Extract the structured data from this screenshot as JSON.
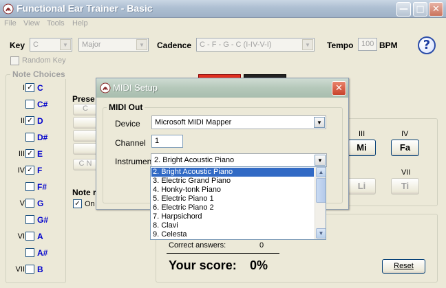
{
  "window": {
    "title": "Functional Ear Trainer - Basic"
  },
  "menu": [
    "File",
    "View",
    "Tools",
    "Help"
  ],
  "controls": {
    "key_label": "Key",
    "key_value": "C",
    "mode_value": "Major",
    "cadence_label": "Cadence",
    "cadence_value": "C - F - G - C (I-IV-V-I)",
    "tempo_label": "Tempo",
    "tempo_value": "100",
    "tempo_unit": "BPM",
    "random_key_label": "Random Key"
  },
  "note_choices": {
    "title": "Note Choices",
    "items": [
      {
        "roman": "I",
        "note": "C",
        "checked": true
      },
      {
        "roman": "",
        "note": "C#",
        "checked": false
      },
      {
        "roman": "II",
        "note": "D",
        "checked": true
      },
      {
        "roman": "",
        "note": "D#",
        "checked": false
      },
      {
        "roman": "III",
        "note": "E",
        "checked": true
      },
      {
        "roman": "IV",
        "note": "F",
        "checked": true
      },
      {
        "roman": "",
        "note": "F#",
        "checked": false
      },
      {
        "roman": "V",
        "note": "G",
        "checked": false
      },
      {
        "roman": "",
        "note": "G#",
        "checked": false
      },
      {
        "roman": "VI",
        "note": "A",
        "checked": false
      },
      {
        "roman": "",
        "note": "A#",
        "checked": false
      },
      {
        "roman": "VII",
        "note": "B",
        "checked": false
      }
    ]
  },
  "presets": {
    "label": "Prese",
    "partial_c": "C",
    "partial_cn": "C N"
  },
  "note_section": {
    "label": "Note r",
    "option": "On"
  },
  "degrees": {
    "row1": [
      {
        "roman": "III",
        "label": "Mi"
      },
      {
        "roman": "IV",
        "label": "Fa"
      }
    ],
    "row2": [
      {
        "roman": "",
        "label": "Li"
      },
      {
        "roman": "VII",
        "label": "Ti"
      }
    ]
  },
  "score": {
    "correct_label": "Correct answers:",
    "correct_value": "0",
    "score_label": "Your score:",
    "score_value": "0%",
    "reset_label": "Reset"
  },
  "midi": {
    "title": "MIDI Setup",
    "group_title": "MIDI Out",
    "device_label": "Device",
    "device_value": "Microsoft MIDI Mapper",
    "channel_label": "Channel",
    "channel_value": "1",
    "instrument_label": "Instrument",
    "instrument_value": "2.  Bright Acoustic Piano",
    "instrument_options": [
      "2.  Bright Acoustic Piano",
      "3.  Electric Grand Piano",
      "4.  Honky-tonk Piano",
      "5.  Electric Piano 1",
      "6.  Electric Piano 2",
      "7.  Harpsichord",
      "8.  Clavi",
      "9.  Celesta"
    ]
  },
  "colors": {
    "note_blue": "#0000cc",
    "selection": "#316ac5"
  }
}
